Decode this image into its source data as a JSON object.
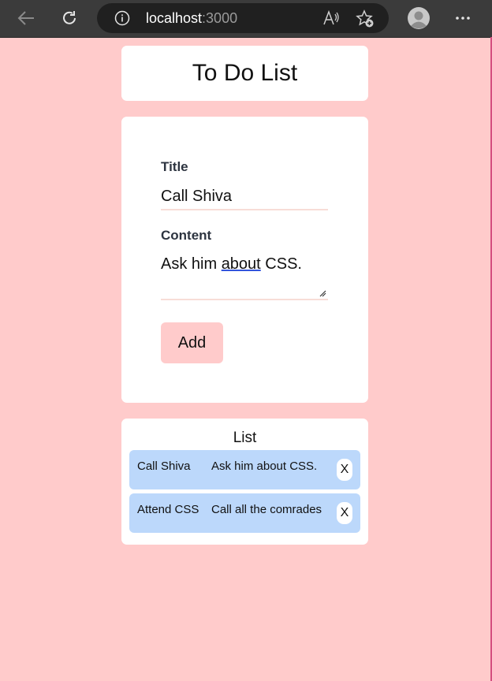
{
  "browser": {
    "url_host": "localhost",
    "url_port": ":3000"
  },
  "header": {
    "title": "To Do List"
  },
  "form": {
    "title_label": "Title",
    "title_value": "Call Shiva",
    "content_label": "Content",
    "content_before": "Ask him ",
    "content_spell": "about",
    "content_after": " CSS.",
    "add_label": "Add"
  },
  "list": {
    "heading": "List",
    "items": [
      {
        "title": "Call Shiva",
        "content": "Ask him about CSS.",
        "delete_label": "X"
      },
      {
        "title": "Attend CSS",
        "content": "Call all the comrades",
        "delete_label": "X"
      }
    ]
  },
  "colors": {
    "page_bg": "#ffcbcb",
    "card_bg": "#ffffff",
    "note_bg": "#bcd8fb",
    "button_bg": "#ffcbcb"
  }
}
